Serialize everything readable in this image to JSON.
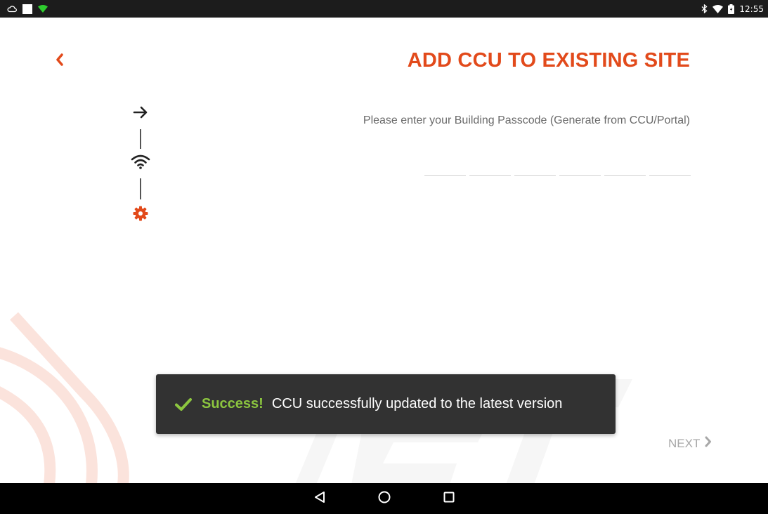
{
  "status_bar": {
    "time": "12:55",
    "left_icons": [
      "cloud-icon",
      "square-notification-icon",
      "wifi-green-icon"
    ],
    "right_icons": [
      "bluetooth-icon",
      "wifi-icon",
      "battery-icon"
    ]
  },
  "header": {
    "title": "ADD CCU TO EXISTING SITE",
    "back_icon": "chevron-left-icon"
  },
  "stepper": {
    "steps": [
      {
        "icon": "arrow-right-icon",
        "active": false
      },
      {
        "icon": "wifi-icon",
        "active": false
      },
      {
        "icon": "gear-icon",
        "active": true
      }
    ]
  },
  "passcode": {
    "instruction": "Please enter your Building Passcode (Generate from CCU/Portal)",
    "digits": [
      "",
      "",
      "",
      "",
      "",
      ""
    ]
  },
  "toast": {
    "strong": "Success!",
    "message": "CCU successfully updated to the latest version",
    "icon": "checkmark-icon"
  },
  "footer": {
    "next_label": "NEXT",
    "next_icon": "chevron-right-icon"
  },
  "nav_bar": {
    "buttons": [
      "back-triangle-icon",
      "home-circle-icon",
      "recents-square-icon"
    ]
  },
  "colors": {
    "accent": "#e24a1b",
    "success": "#8cc63f",
    "toast_bg": "#323232",
    "status_bar_bg": "#1c1c1c"
  }
}
